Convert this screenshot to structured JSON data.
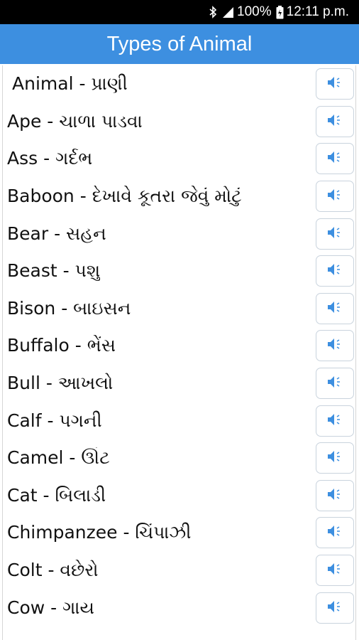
{
  "status_bar": {
    "battery": "100%",
    "time": "12:11 p.m.",
    "icons": [
      "bluetooth-icon",
      "signal-icon",
      "battery-icon"
    ]
  },
  "app_bar": {
    "title": "Types of Animal"
  },
  "colors": {
    "app_bar": "#3d8fe0",
    "status_bar": "#000000",
    "speaker": "#3d8fe0"
  },
  "animals": [
    "Animal - પ્રાણી",
    "Ape - ચાળા પાડવા",
    "Ass - ગર્દભ",
    "Baboon - દેખાવે કૂતરા જેવું મોટું",
    "Bear - સહન",
    "Beast - પશુ",
    "Bison - બાઇસન",
    "Buffalo - ભેંસ",
    "Bull - આખલો",
    "Calf - પગની",
    "Camel - ઊંટ",
    "Cat - બિલાડી",
    "Chimpanzee - ચિંપાઝી",
    "Colt - વછેરો",
    "Cow - ગાય"
  ]
}
